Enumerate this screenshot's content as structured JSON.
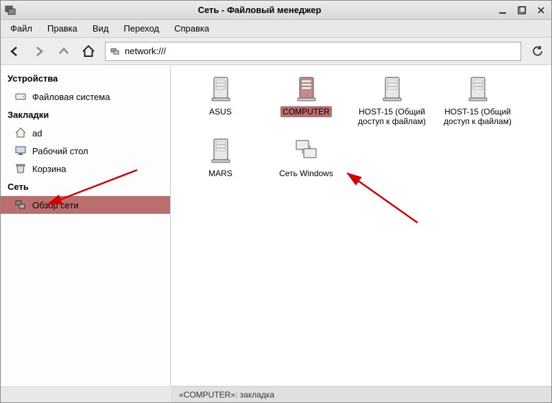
{
  "titlebar": {
    "title": "Сеть - Файловый менеджер"
  },
  "menubar": {
    "items": [
      "Файл",
      "Правка",
      "Вид",
      "Переход",
      "Справка"
    ]
  },
  "address": {
    "value": "network:///"
  },
  "sidebar": {
    "sections": [
      {
        "header": "Устройства",
        "items": [
          {
            "icon": "drive",
            "label": "Файловая система",
            "selected": false
          }
        ]
      },
      {
        "header": "Закладки",
        "items": [
          {
            "icon": "home",
            "label": "ad",
            "selected": false
          },
          {
            "icon": "desktop",
            "label": "Рабочий стол",
            "selected": false
          },
          {
            "icon": "trash",
            "label": "Корзина",
            "selected": false
          }
        ]
      },
      {
        "header": "Сеть",
        "items": [
          {
            "icon": "network",
            "label": "Обзор сети",
            "selected": true
          }
        ]
      }
    ]
  },
  "grid": {
    "items": [
      {
        "icon": "server",
        "label": "ASUS",
        "selected": false
      },
      {
        "icon": "server",
        "label": "COMPUTER",
        "selected": true
      },
      {
        "icon": "server",
        "label": "HOST-15 (Общий доступ к файлам)",
        "selected": false
      },
      {
        "icon": "server",
        "label": "HOST-15 (Общий доступ к файлам)",
        "selected": false
      },
      {
        "icon": "server",
        "label": "MARS",
        "selected": false
      },
      {
        "icon": "network-group",
        "label": "Сеть Windows",
        "selected": false
      }
    ]
  },
  "statusbar": {
    "text": "«COMPUTER»: закладка"
  }
}
